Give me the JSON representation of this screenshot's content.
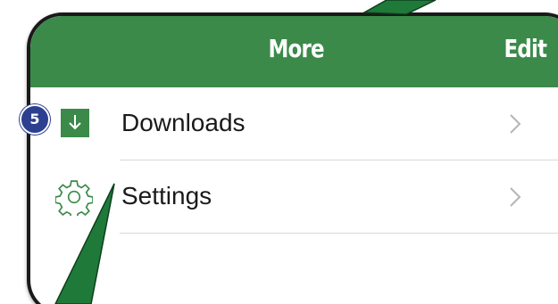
{
  "navbar": {
    "title": "More",
    "edit_label": "Edit",
    "color": "#3b8a4a"
  },
  "list": {
    "items": [
      {
        "label": "Downloads",
        "icon": "download-icon"
      },
      {
        "label": "Settings",
        "icon": "gear-icon"
      }
    ]
  },
  "callout": {
    "step_number": "5",
    "badge_color": "#2d3f8f",
    "pointer_color": "#1f7a3a"
  }
}
